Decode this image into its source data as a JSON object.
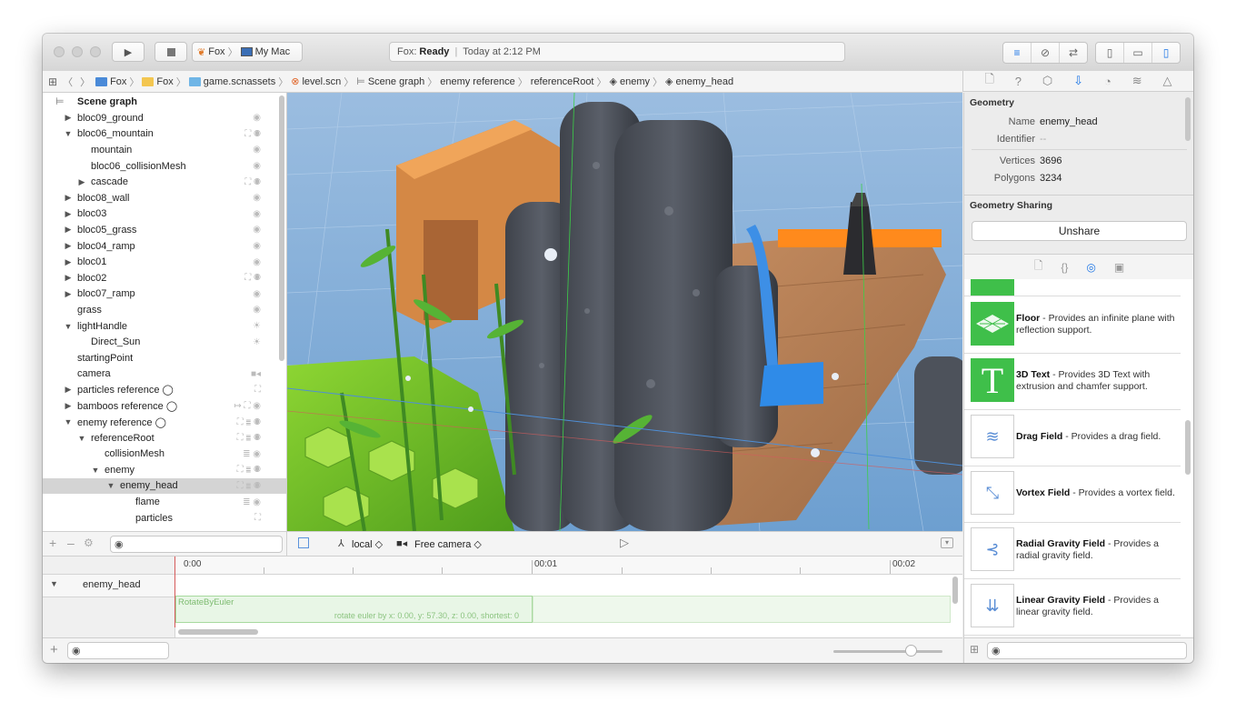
{
  "toolbar": {
    "scheme_app": "Fox",
    "scheme_device": "My Mac",
    "status_prefix": "Fox:",
    "status_state": "Ready",
    "status_time": "Today at 2:12 PM"
  },
  "jumpbar": [
    "Fox",
    "Fox",
    "game.scnassets",
    "level.scn",
    "Scene graph",
    "enemy reference",
    "referenceRoot",
    "enemy",
    "enemy_head"
  ],
  "outline": {
    "title": "Scene graph",
    "rows": [
      {
        "label": "bloc09_ground",
        "indent": 1,
        "expander": "closed",
        "icons": "◉"
      },
      {
        "label": "bloc06_mountain",
        "indent": 1,
        "expander": "open",
        "icons": "⛶ ◉"
      },
      {
        "label": "mountain",
        "indent": 2,
        "expander": "none",
        "icons": "◉"
      },
      {
        "label": "bloc06_collisionMesh",
        "indent": 2,
        "expander": "none",
        "icons": "◉"
      },
      {
        "label": "cascade",
        "indent": 2,
        "expander": "closed",
        "icons": "⛶ ◉"
      },
      {
        "label": "bloc08_wall",
        "indent": 1,
        "expander": "closed",
        "icons": "◉"
      },
      {
        "label": "bloc03",
        "indent": 1,
        "expander": "closed",
        "icons": "◉"
      },
      {
        "label": "bloc05_grass",
        "indent": 1,
        "expander": "closed",
        "icons": "◉"
      },
      {
        "label": "bloc04_ramp",
        "indent": 1,
        "expander": "closed",
        "icons": "◉"
      },
      {
        "label": "bloc01",
        "indent": 1,
        "expander": "closed",
        "icons": "◉"
      },
      {
        "label": "bloc02",
        "indent": 1,
        "expander": "closed",
        "icons": "⛶ ◉"
      },
      {
        "label": "bloc07_ramp",
        "indent": 1,
        "expander": "closed",
        "icons": "◉"
      },
      {
        "label": "grass",
        "indent": 1,
        "expander": "none",
        "icons": "◉"
      },
      {
        "label": "lightHandle",
        "indent": 1,
        "expander": "open",
        "icons": "☀"
      },
      {
        "label": "Direct_Sun",
        "indent": 2,
        "expander": "none",
        "icons": "☀"
      },
      {
        "label": "startingPoint",
        "indent": 1,
        "expander": "none",
        "icons": ""
      },
      {
        "label": "camera",
        "indent": 1,
        "expander": "none",
        "icons": "■◂"
      },
      {
        "label": "particles reference ◯",
        "indent": 1,
        "expander": "closed",
        "icons": "⛶"
      },
      {
        "label": "bamboos reference ◯",
        "indent": 1,
        "expander": "closed",
        "icons": "↦ ⛶ ◉"
      },
      {
        "label": "enemy reference ◯",
        "indent": 1,
        "expander": "open",
        "icons": "⛶ ≣ ◉"
      },
      {
        "label": "referenceRoot",
        "indent": 2,
        "expander": "open",
        "icons": "⛶ ≣ ◉"
      },
      {
        "label": "collisionMesh",
        "indent": 3,
        "expander": "none",
        "icons": "≣ ◉"
      },
      {
        "label": "enemy",
        "indent": 3,
        "expander": "open",
        "icons": "⛶ ≣ ◉"
      },
      {
        "label": "enemy_head",
        "indent": 4,
        "expander": "open",
        "icons": "⛶ ≣ ◉",
        "selected": true
      },
      {
        "label": "flame",
        "indent": 5,
        "expander": "none",
        "icons": "≣ ◉"
      },
      {
        "label": "particles",
        "indent": 5,
        "expander": "none",
        "icons": "⛶"
      }
    ]
  },
  "viewport_bar": {
    "space": "local ◇",
    "camera": "Free camera ◇"
  },
  "timeline": {
    "node": "enemy_head",
    "ticks": [
      "0:00",
      "00:01",
      "00:02"
    ],
    "action_name": "RotateByEuler",
    "action_desc": "rotate euler by x: 0.00, y: 57.30, z: 0.00, shortest: 0"
  },
  "inspector": {
    "section_geometry": "Geometry",
    "name_label": "Name",
    "name_value": "enemy_head",
    "identifier_label": "Identifier",
    "identifier_value": "--",
    "vertices_label": "Vertices",
    "vertices_value": "3696",
    "polygons_label": "Polygons",
    "polygons_value": "3234",
    "section_sharing": "Geometry Sharing",
    "unshare_label": "Unshare"
  },
  "library": [
    {
      "title": "Floor",
      "desc": " - Provides an infinite plane with reflection support.",
      "icon": "floor-icon"
    },
    {
      "title": "3D Text",
      "desc": " - Provides 3D Text with extrusion and chamfer support.",
      "icon": "text-3d-icon"
    },
    {
      "title": "Drag Field",
      "desc": " - Provides a drag field.",
      "icon": "drag-field-icon"
    },
    {
      "title": "Vortex Field",
      "desc": " - Provides a vortex field.",
      "icon": "vortex-field-icon"
    },
    {
      "title": "Radial Gravity Field",
      "desc": " - Provides a radial gravity field.",
      "icon": "radial-gravity-icon"
    },
    {
      "title": "Linear Gravity Field",
      "desc": " - Provides a linear gravity field.",
      "icon": "linear-gravity-icon"
    }
  ],
  "colors": {
    "accent": "#1c75e6",
    "library_green": "#3fbf4a",
    "timeline_action": "#e8f6e6"
  }
}
